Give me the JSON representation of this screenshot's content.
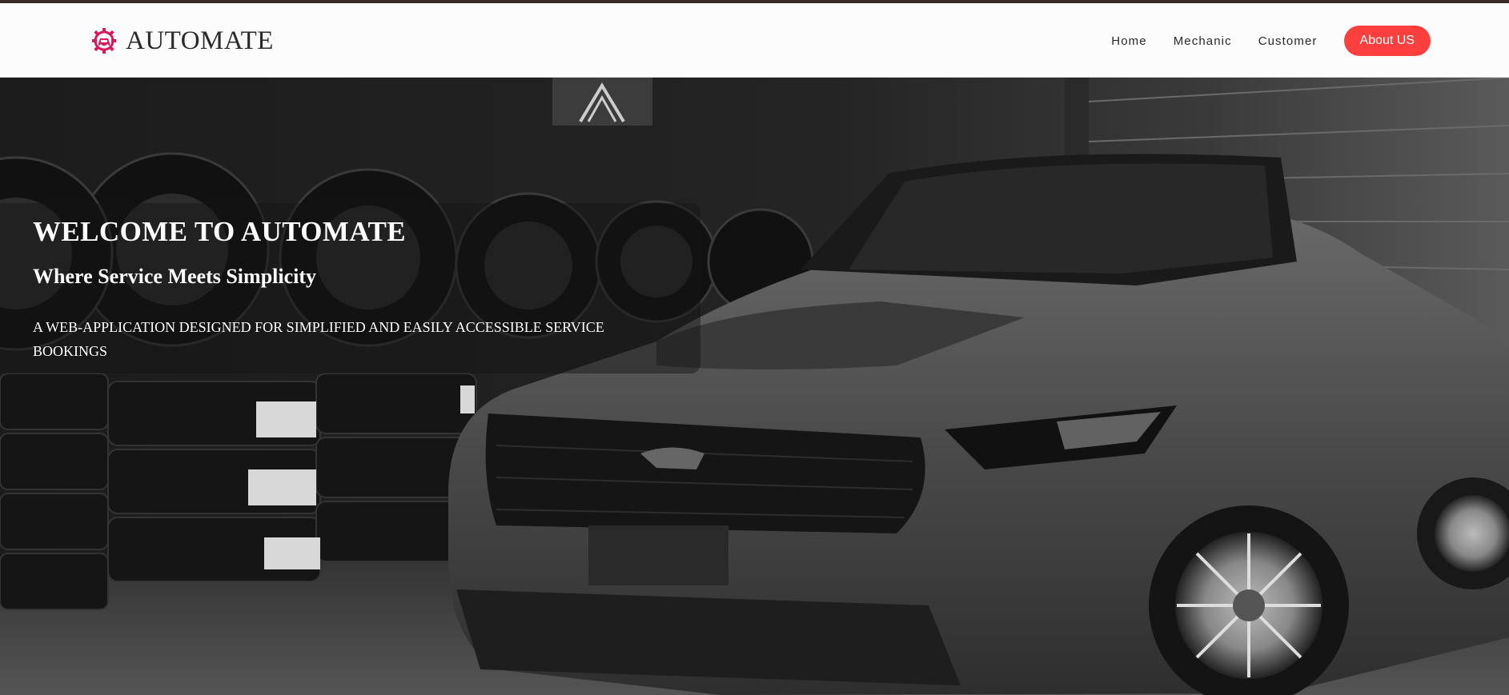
{
  "brand": {
    "name": "AUTOMATE",
    "logo_icon": "car-gear-icon",
    "logo_color": "#d81b60"
  },
  "nav": {
    "links": [
      {
        "label": "Home"
      },
      {
        "label": "Mechanic"
      },
      {
        "label": "Customer"
      }
    ],
    "about_button": "About US",
    "accent_color": "#ff3e3e"
  },
  "hero": {
    "title": "WELCOME TO AUTOMATE",
    "subtitle": "Where Service Meets Simplicity",
    "description": "A WEB-APPLICATION DESIGNED FOR SIMPLIFIED AND EASILY ACCESSIBLE SERVICE BOOKINGS",
    "background_image": "black-and-white-sports-car-in-garage-with-tires"
  }
}
